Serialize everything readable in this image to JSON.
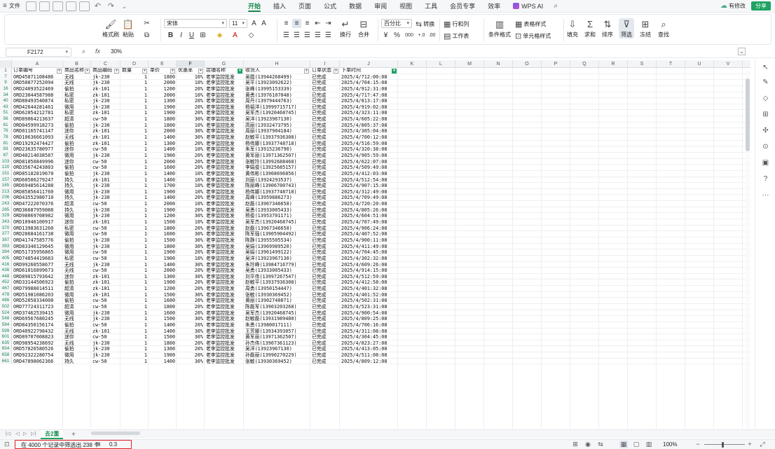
{
  "menubar": {
    "file": "文件",
    "tabs": [
      "开始",
      "插入",
      "页面",
      "公式",
      "数据",
      "审阅",
      "视图",
      "工具",
      "会员专享",
      "效率"
    ],
    "active_tab": "开始",
    "wps_ai": "WPS AI",
    "modified": "有修改",
    "share": "分享"
  },
  "ribbon": {
    "format_painter": "格式刷",
    "paste": "粘贴",
    "font_name": "宋体",
    "font_size": "11",
    "bold": "B",
    "italic": "I",
    "underline": "U",
    "wrap": "换行",
    "merge": "合并",
    "number_format": "百分比",
    "convert": "转换",
    "percent": "%",
    "thousand": "000",
    "row_col": "行和列",
    "worksheet": "工作表",
    "cond_format": "条件格式",
    "table_style": "表格样式",
    "cell_style": "单元格样式",
    "fill": "填充",
    "sum": "求和",
    "sort": "排序",
    "filter": "筛选",
    "freeze": "冻结",
    "find": "查找"
  },
  "formula_bar": {
    "cell": "F2172",
    "fx": "fx",
    "value": "30%"
  },
  "columns": [
    "A",
    "B",
    "C",
    "D",
    "E",
    "F",
    "G",
    "H",
    "I",
    "J",
    "K",
    "L",
    "M",
    "N",
    "O",
    "P",
    "Q",
    "R",
    "S",
    "T",
    "U",
    "V"
  ],
  "header_row": {
    "num": "1",
    "cells": [
      "订单编号",
      "商品名称",
      "商品编码",
      "数量",
      "单价",
      "优惠率",
      "店铺名称",
      "收货人",
      "订单状态",
      "下单时间"
    ]
  },
  "table_rows": [
    [
      "7",
      "ORD45871108486",
      "无线",
      "jk-230",
      "1",
      "1800",
      "10%",
      "老李监控批发",
      "吴霞(13944268499)",
      "已完成",
      "2025/4/712:00:08"
    ],
    [
      "9",
      "ORD50877252094",
      "无线",
      "jk-230",
      "1",
      "2000",
      "10%",
      "老李监控批发",
      "吴平(13923092622)",
      "已完成",
      "2025/4/704:15:08"
    ],
    [
      "16",
      "ORD24093522469",
      "偷拍",
      "zk-101",
      "1",
      "1200",
      "20%",
      "老李监控批发",
      "张峰(13995153339)",
      "已完成",
      "2025/4/912:31:08"
    ],
    [
      "34",
      "ORD23044587988",
      "私密",
      "zk-101",
      "1",
      "2000",
      "10%",
      "老李监控批发",
      "黄勇(13976107048)",
      "已完成",
      "2025/4/717:47:08"
    ],
    [
      "40",
      "ORD80493540874",
      "私密",
      "jk-230",
      "1",
      "1300",
      "20%",
      "老李监控批发",
      "周丹(13979444763)",
      "已完成",
      "2025/4/813:17:08"
    ],
    [
      "43",
      "ORD42644281461",
      "微用",
      "jk-230",
      "1",
      "1900",
      "20%",
      "老李监控批发",
      "杨韬洋(13999715717)",
      "已完成",
      "2025/4/919:02:08"
    ],
    [
      "51",
      "ORD62054212781",
      "私密",
      "zk-101",
      "1",
      "1900",
      "20%",
      "老李监控批发",
      "吴军杰(13920468745)",
      "已完成",
      "2025/4/323:11:08"
    ],
    [
      "56",
      "ORD89064213637",
      "超清",
      "cw-50",
      "1",
      "1800",
      "30%",
      "老李监控批发",
      "吴洋(13923967130)",
      "已完成",
      "2025/4/605:22:08"
    ],
    [
      "61",
      "ORD04599918273",
      "偷拍",
      "jk-230",
      "1",
      "1800",
      "10%",
      "老李监控批发",
      "高丽(13932473795)",
      "已完成",
      "2025/4/805:37:08"
    ],
    [
      "76",
      "ORD01165741147",
      "迷你",
      "zk-101",
      "1",
      "2000",
      "30%",
      "老李监控批发",
      "周丽(13937904184)",
      "已完成",
      "2025/4/305:04:08"
    ],
    [
      "78",
      "ORD10636661093",
      "无线",
      "zk-101",
      "1",
      "1400",
      "30%",
      "老李监控批发",
      "赵敏平(13937936308)",
      "已完成",
      "2025/4/700:12:08"
    ],
    [
      "81",
      "ORD19292474427",
      "偷拍",
      "zk-101",
      "1",
      "1300",
      "20%",
      "老李监控批发",
      "杨伟娜(13937748718)",
      "已完成",
      "2025/4/516:59:08"
    ],
    [
      "83",
      "ORD23635780977",
      "迷你",
      "cw-50",
      "1",
      "1400",
      "10%",
      "老李监控批发",
      "朱军(13915236790)",
      "已完成",
      "2025/4/320:38:08"
    ],
    [
      "87",
      "ORD40214038587",
      "微用",
      "jk-230",
      "1",
      "1900",
      "20%",
      "老李监控批发",
      "黄军丽(13971362507)",
      "已完成",
      "2025/4/905:59:08"
    ],
    [
      "103",
      "ORD81050849996",
      "迷你",
      "cw-50",
      "1",
      "2000",
      "20%",
      "老李监控批发",
      "张敏玲(13992688468)",
      "已完成",
      "2025/4/622:07:08"
    ],
    [
      "120",
      "ORD35674243803",
      "偷拍",
      "cw-50",
      "1",
      "1600",
      "20%",
      "老李监控批发",
      "李娟俊(13925685157)",
      "已完成",
      "2025/4/509:49:08"
    ],
    [
      "151",
      "ORD85182819670",
      "偷拍",
      "jk-230",
      "1",
      "1400",
      "10%",
      "老李监控批发",
      "黄伟彬(13908696856)",
      "已完成",
      "2025/4/412:03:08"
    ],
    [
      "157",
      "ORD60506279247",
      "持久",
      "zk-101",
      "1",
      "1400",
      "10%",
      "老李监控批发",
      "刘丽(13924293537)",
      "已完成",
      "2025/4/512:54:08"
    ],
    [
      "165",
      "ORD69485614288",
      "持久",
      "jk-230",
      "1",
      "1700",
      "10%",
      "老李监控批发",
      "陈丽峰(13906700743)",
      "已完成",
      "2025/4/907:15:08"
    ],
    [
      "213",
      "ORD85856411760",
      "微用",
      "jk-230",
      "1",
      "1900",
      "10%",
      "老李监控批发",
      "杨伟娜(13937748718)",
      "已完成",
      "2025/4/312:49:08"
    ],
    [
      "236",
      "ORD43552980710",
      "持久",
      "jk-230",
      "1",
      "1400",
      "20%",
      "老李监控批发",
      "周峰(13959886273)",
      "已完成",
      "2025/4/709:49:08"
    ],
    [
      "243",
      "ORD47222070376",
      "超清",
      "cw-50",
      "1",
      "2000",
      "10%",
      "老李监控批发",
      "赵磊(13967346658)",
      "已完成",
      "2025/4/720:20:08"
    ],
    [
      "285",
      "ORD36687959088",
      "持久",
      "jk-230",
      "1",
      "1900",
      "20%",
      "老李监控批发",
      "吴勇(13933005433)",
      "已完成",
      "2025/4/805:26:08"
    ],
    [
      "329",
      "ORD98069708982",
      "微用",
      "jk-230",
      "1",
      "1200",
      "30%",
      "老李监控批发",
      "杨俊(13953701171)",
      "已完成",
      "2025/4/604:51:08"
    ],
    [
      "343",
      "ORD10946100917",
      "迷你",
      "zk-101",
      "1",
      "1500",
      "10%",
      "老李监控批发",
      "吴军杰(13920468745)",
      "已完成",
      "2025/4/707:49:08"
    ],
    [
      "370",
      "ORD13983631260",
      "私密",
      "cw-50",
      "1",
      "1800",
      "20%",
      "老李监控批发",
      "赵磊(13967346658)",
      "已完成",
      "2025/4/906:24:08"
    ],
    [
      "377",
      "ORD28684161738",
      "微用",
      "cw-50",
      "1",
      "1600",
      "30%",
      "老李监控批发",
      "陈军强(13905904492)",
      "已完成",
      "2025/4/407:52:08"
    ],
    [
      "387",
      "ORD41747585776",
      "偷拍",
      "jk-230",
      "1",
      "1500",
      "30%",
      "老李监控批发",
      "陈静(13955505534)",
      "已完成",
      "2025/4/900:11:08"
    ],
    [
      "393",
      "ORD83340129645",
      "微用",
      "jk-230",
      "1",
      "1800",
      "30%",
      "老李监控批发",
      "吴娟(13969989520)",
      "已完成",
      "2025/4/411:49:08"
    ],
    [
      "394",
      "ORD51735956865",
      "微用",
      "cw-50",
      "1",
      "1900",
      "20%",
      "老李监控批发",
      "吴娟(13961499122)",
      "已完成",
      "2025/4/704:45:08"
    ],
    [
      "405",
      "ORD74854419683",
      "私密",
      "cw-50",
      "1",
      "1900",
      "10%",
      "老李监控批发",
      "吴洋(13923967130)",
      "已完成",
      "2025/4/302:32:08"
    ],
    [
      "416",
      "ORD99260558677",
      "无线",
      "jk-230",
      "1",
      "1400",
      "30%",
      "老李监控批发",
      "朱玲峰(13984716779)",
      "已完成",
      "2025/4/609:26:08"
    ],
    [
      "436",
      "ORD61016899673",
      "无线",
      "cw-50",
      "1",
      "2000",
      "20%",
      "老李监控批发",
      "吴勇(13933005433)",
      "已完成",
      "2025/4/914:15:08"
    ],
    [
      "448",
      "ORD89015793642",
      "迷你",
      "zk-101",
      "1",
      "1300",
      "30%",
      "老李监控批发",
      "刘平伟(13997267547)",
      "已完成",
      "2025/4/512:59:08"
    ],
    [
      "452",
      "ORD33144506923",
      "偷拍",
      "zk-101",
      "1",
      "1900",
      "20%",
      "老李监控批发",
      "赵敏平(13937936308)",
      "已完成",
      "2025/4/412:58:08"
    ],
    [
      "467",
      "ORD79988014511",
      "超清",
      "zk-101",
      "1",
      "1200",
      "20%",
      "老李监控批发",
      "周勇(13950154447)",
      "已完成",
      "2025/4/401:32:08"
    ],
    [
      "478",
      "ORD51981086203",
      "微用",
      "zk-101",
      "1",
      "1500",
      "30%",
      "老李监控批发",
      "张敏(13930369452)",
      "已完成",
      "2025/4/401:52:08"
    ],
    [
      "486",
      "ORD52058334008",
      "偷拍",
      "cw-50",
      "1",
      "1600",
      "20%",
      "老李监控批发",
      "黄丽(13902740871)",
      "已完成",
      "2025/4/502:31:08"
    ],
    [
      "502",
      "ORD77724311723",
      "超清",
      "cw-50",
      "1",
      "1800",
      "20%",
      "老李监控批发",
      "陈磊军(13903203268)",
      "已完成",
      "2025/4/523:31:08"
    ],
    [
      "524",
      "ORD37462539415",
      "微用",
      "jk-230",
      "1",
      "1600",
      "20%",
      "老李监控批发",
      "吴军杰(13920468745)",
      "已完成",
      "2025/4/900:54:08"
    ],
    [
      "548",
      "ORD69567680245",
      "无线",
      "jk-230",
      "1",
      "1500",
      "30%",
      "老李监控批发",
      "赵敏磊(13931989480)",
      "已完成",
      "2025/4/809:25:08"
    ],
    [
      "584",
      "ORD84350156174",
      "偷拍",
      "cw-50",
      "1",
      "1400",
      "20%",
      "老李监控批发",
      "朱勇(13980017111)",
      "已完成",
      "2025/4/706:16:08"
    ],
    [
      "599",
      "ORD40922798432",
      "无线",
      "zk-101",
      "1",
      "1400",
      "30%",
      "老李监控批发",
      "王芳娜(13934393057)",
      "已完成",
      "2025/4/311:08:08"
    ],
    [
      "601",
      "ORD89707008823",
      "迷你",
      "cw-50",
      "1",
      "1500",
      "30%",
      "老李监控批发",
      "黄军丽(13971362507)",
      "已完成",
      "2025/4/304:45:08"
    ],
    [
      "635",
      "ORD98954238692",
      "无线",
      "jk-230",
      "1",
      "1800",
      "20%",
      "老李监控批发",
      "孙杰伟(13907361123)",
      "已完成",
      "2025/4/823:27:08"
    ],
    [
      "654",
      "ORD57826580526",
      "偷拍",
      "jk-230",
      "1",
      "1300",
      "20%",
      "老李监控批发",
      "吴洋(13923967130)",
      "已完成",
      "2025/4/413:05:08"
    ],
    [
      "658",
      "ORD92322280754",
      "微用",
      "jk-230",
      "1",
      "1900",
      "20%",
      "老李监控批发",
      "孙磊丽(13990270229)",
      "已完成",
      "2025/4/511:08:08"
    ],
    [
      "661",
      "ORD47898062366",
      "持久",
      "cw-50",
      "1",
      "1400",
      "30%",
      "老李监控批发",
      "张敏(13930369452)",
      "已完成",
      "2025/4/809:12:08"
    ]
  ],
  "sheet": {
    "name": "去2重",
    "add": "+"
  },
  "status": {
    "filter_text": "在 4000 个记录中筛选出 238 个",
    "sum_value": "0.3",
    "zoom": "100%"
  },
  "sidebar_icons": [
    "cursor-icon",
    "pen-icon",
    "shape-icon",
    "grid-icon",
    "magic-icon",
    "camera-icon",
    "image-icon",
    "question-icon",
    "more-icon"
  ]
}
